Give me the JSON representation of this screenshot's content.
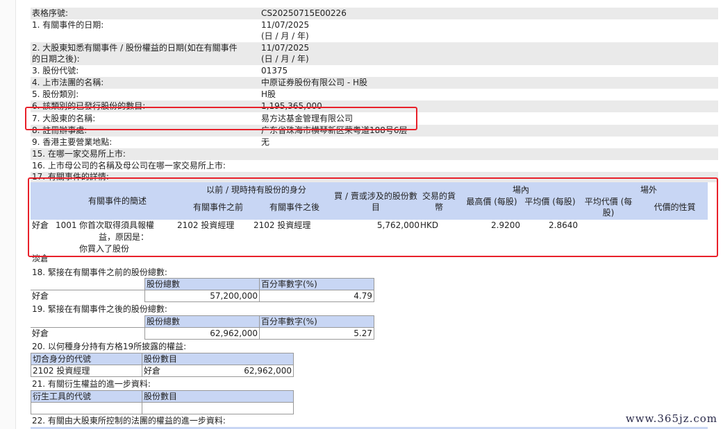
{
  "form": {
    "serial": {
      "label": "表格序號:",
      "value": "CS20250715E00226"
    },
    "event_date": {
      "label": "1. 有關事件的日期:",
      "value": "11/07/2025",
      "fmt": "(日 / 月 / 年)"
    },
    "aware_date": {
      "label1": "2. 大股東知悉有關事件 / 股份權益的日期(如在有關事件",
      "label2": "的日期之後):",
      "value": "11/07/2025",
      "fmt": "(日 / 月 / 年)"
    },
    "stock_code": {
      "label": "3. 股份代號:",
      "value": "01375"
    },
    "issuer": {
      "label": "4. 上市法團的名稱:",
      "value": "中原证券股份有限公司 - H股"
    },
    "share_class": {
      "label": "5. 股份類別:",
      "value": "H股"
    },
    "issued_shares": {
      "label": "6. 該類別的已發行股份的數目:",
      "value": "1,195,365,000"
    },
    "holder_name": {
      "label": "7. 大股東的名稱:",
      "value": "易方达基金管理有限公司"
    },
    "reg_address": {
      "label": "8. 註冊辦事處:",
      "value": "广东省珠海市横琴新区荣粤道188号6层"
    },
    "hk_office": {
      "label": "9. 香港主要營業地點:",
      "value": "无"
    },
    "q15": {
      "label": "15. 在哪一家交易所上市:"
    },
    "q16": {
      "label": "16. 上市母公司的名稱及母公司在哪一家交易所上市:"
    },
    "q17": {
      "label": "17. 有關事件的詳情:"
    }
  },
  "event_table": {
    "headers": {
      "desc": "有關事件的簡述",
      "capacity_group": "以前 / 現時持有股份的身分",
      "before": "有關事件之前",
      "after": "有關事件之後",
      "shares": "買 / 賣或涉及的股份數目",
      "currency": "交易的貨幣",
      "onex": "場內",
      "high": "最高價 (每股)",
      "avg": "平均價 (每股)",
      "offex": "場外",
      "offavg": "平均代價 (每股)",
      "nature": "代價的性質"
    },
    "row": {
      "pos": "好倉",
      "code": "1001",
      "desc1": "你首次取得須具報權",
      "desc2": "益，原因是：",
      "desc3": "你買入了股份",
      "before": "2102 投資經理",
      "after": "2102 投資經理",
      "shares": "5,762,000",
      "currency": "HKD",
      "high": "2.9200",
      "avg": "2.8640"
    },
    "trailing": "淡倉"
  },
  "q18": {
    "label": "18. 緊接在有關事件之前的股份總數:",
    "h1": "股份總數",
    "h2": "百分率數字(%)",
    "pos": "好倉",
    "shares": "57,200,000",
    "pct": "4.79"
  },
  "q19": {
    "label": "19. 緊接在有關事件之後的股份總數:",
    "h1": "股份總數",
    "h2": "百分率數字(%)",
    "pos": "好倉",
    "shares": "62,962,000",
    "pct": "5.27"
  },
  "q20": {
    "label": "20. 以何種身分持有方格19所披露的權益:",
    "h1": "切合身分的代號",
    "h2": "股份數目",
    "code": "2102 投資經理",
    "pos": "好倉",
    "shares": "62,962,000"
  },
  "q21": {
    "label": "21. 有關衍生權益的進一步資料:",
    "h1": "衍生工具的代號",
    "h2": "股份數目"
  },
  "q22": {
    "label": "22. 有關由大股東所控制的法團的權益的進一步資料:"
  },
  "watermark": "www.365jz.com",
  "colors": {
    "highlight": "#e8202a",
    "header": "#c8d6f4",
    "shade": "#eaeaea"
  }
}
